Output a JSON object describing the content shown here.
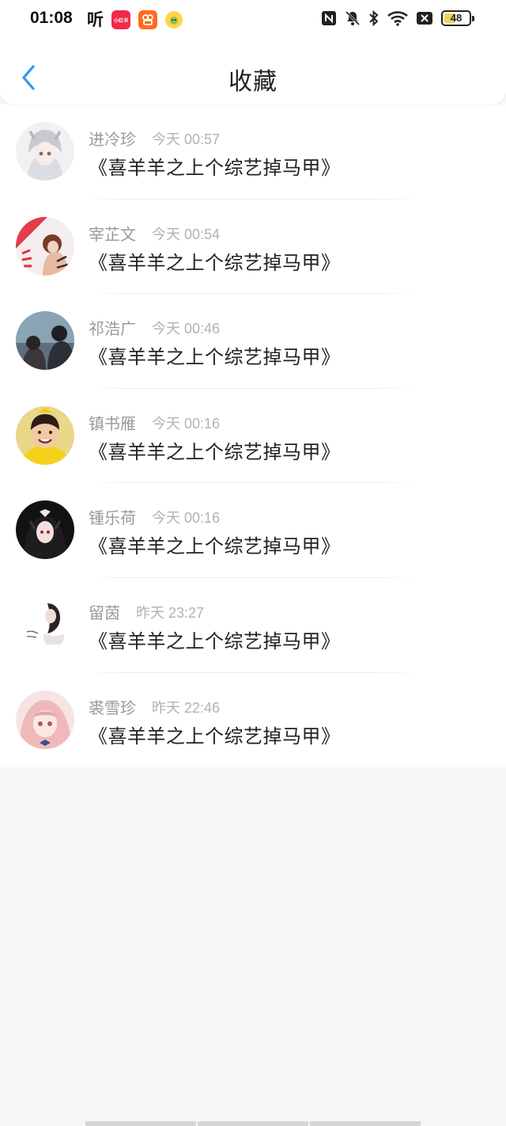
{
  "status_bar": {
    "time": "01:08",
    "ting_label": "听",
    "app_icons": [
      "ting-icon",
      "xiaohongshu-icon",
      "kuaishou-icon",
      "yellow-app-icon"
    ],
    "xiaohongshu_text": "小红书",
    "right_icons": [
      "nfc-icon",
      "bell-muted-icon",
      "bluetooth-icon",
      "wifi-icon",
      "sim-off-icon",
      "battery-icon"
    ],
    "battery_level": "48",
    "battery_fraction": 0.48
  },
  "header": {
    "title": "收藏",
    "back_icon": "chevron-left-icon"
  },
  "colors": {
    "accent_blue": "#2f9af0",
    "background": "#f8f7f8",
    "name_gray": "#9a9a9a",
    "time_gray": "#b2b2b2",
    "title_text": "#222222"
  },
  "favorites": [
    {
      "name": "进冷珍",
      "time": "今天 00:57",
      "title": "《喜羊羊之上个综艺掉马甲》"
    },
    {
      "name": "宰芷文",
      "time": "今天 00:54",
      "title": "《喜羊羊之上个综艺掉马甲》"
    },
    {
      "name": "祁浩广",
      "time": "今天 00:46",
      "title": "《喜羊羊之上个综艺掉马甲》"
    },
    {
      "name": "镇书雁",
      "time": "今天 00:16",
      "title": "《喜羊羊之上个综艺掉马甲》"
    },
    {
      "name": "锺乐荷",
      "time": "今天 00:16",
      "title": "《喜羊羊之上个综艺掉马甲》"
    },
    {
      "name": "留茵",
      "time": "昨天 23:27",
      "title": "《喜羊羊之上个综艺掉马甲》"
    },
    {
      "name": "裘雪珍",
      "time": "昨天 22:46",
      "title": "《喜羊羊之上个综艺掉马甲》"
    }
  ]
}
